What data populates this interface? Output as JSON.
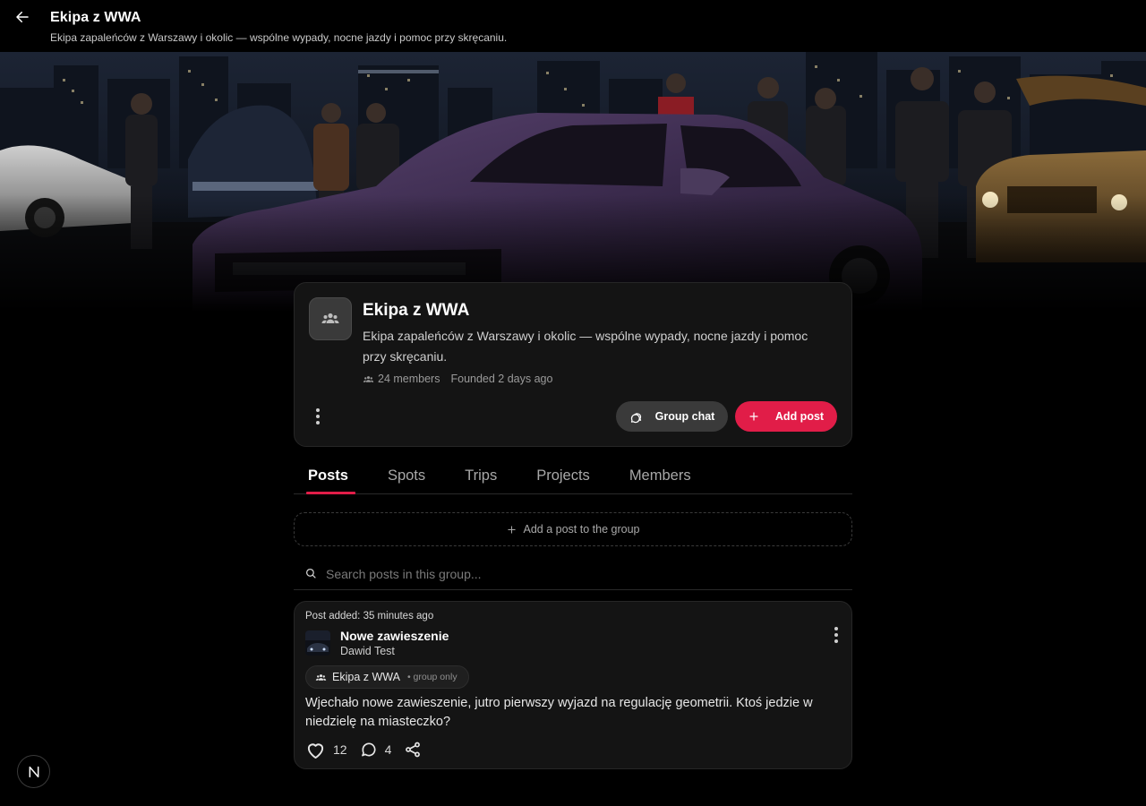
{
  "header": {
    "back_icon": "arrow-left-icon",
    "title": "Ekipa z WWA",
    "subtitle": "Ekipa zapaleńców z Warszawy i okolic — wspólne wypady, nocne jazdy i pomoc przy skręcaniu."
  },
  "group": {
    "avatar_icon": "users-icon",
    "name": "Ekipa z WWA",
    "description": "Ekipa zapaleńców z Warszawy i okolic — wspólne wypady, nocne jazdy i pomoc przy skręcaniu.",
    "members": "24 members",
    "founded": "Founded 2 days ago",
    "chat_label": "Group chat",
    "add_post_label": "Add post"
  },
  "tabs": [
    {
      "label": "Posts",
      "active": true
    },
    {
      "label": "Spots",
      "active": false
    },
    {
      "label": "Trips",
      "active": false
    },
    {
      "label": "Projects",
      "active": false
    },
    {
      "label": "Members",
      "active": false
    }
  ],
  "add_post_prompt": "Add a post to the group",
  "search": {
    "placeholder": "Search posts in this group...",
    "value": ""
  },
  "post": {
    "added": "Post added: 35 minutes ago",
    "title": "Nowe zawieszenie",
    "author": "Dawid Test",
    "group_name": "Ekipa z WWA",
    "visibility": "• group only",
    "body": "Wjechało nowe zawieszenie, jutro pierwszy wyjazd na regulację geometrii. Ktoś jedzie w niedzielę na miasteczko?",
    "likes": "12",
    "comments": "4"
  },
  "colors": {
    "accent": "#e11d48",
    "card_bg": "#141414",
    "page_bg": "#000000"
  },
  "floating_badge": "N"
}
